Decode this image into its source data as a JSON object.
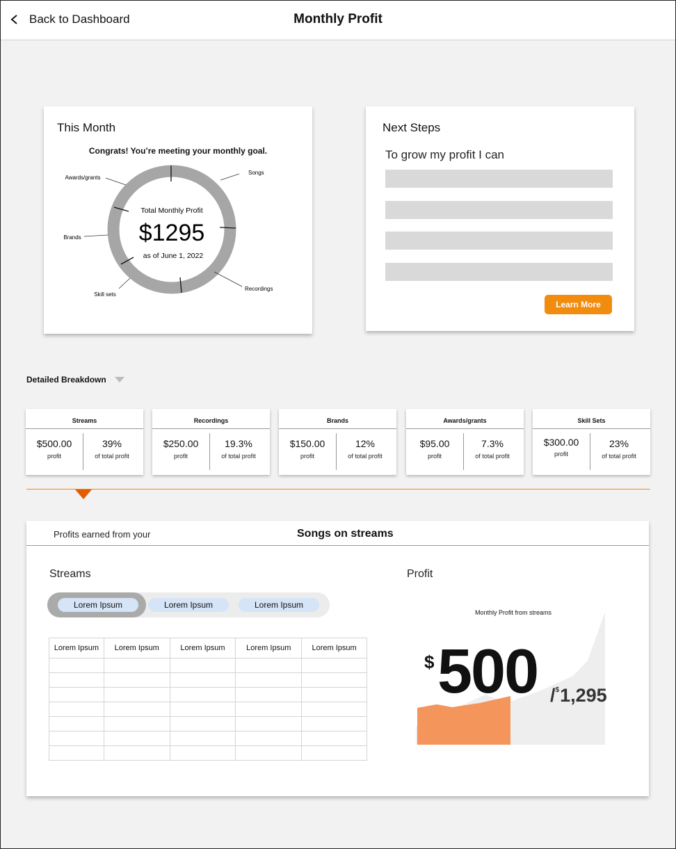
{
  "header": {
    "back_label": "Back to Dashboard",
    "title": "Monthly Profit"
  },
  "this_month": {
    "title": "This Month",
    "congrats": "Congrats! You’re meeting your monthly goal.",
    "donut_title": "Total Monthly Profit",
    "donut_value": "$1295",
    "donut_date": "as of June 1, 2022",
    "segment_labels": {
      "awards": "Awards/grants",
      "songs": "Songs",
      "brands": "Brands",
      "recordings": "Recordings",
      "skill_sets": "Skill sets"
    },
    "ring_color": "#a6a6a6"
  },
  "next_steps": {
    "title": "Next Steps",
    "subtitle": "To grow my profit I can",
    "learn_more": "Learn More",
    "accent": "#f28c0f"
  },
  "breakdown": {
    "label": "Detailed Breakdown",
    "cards": [
      {
        "title": "Streams",
        "amount": "$500.00",
        "amount_label": "profit",
        "pct": "39%",
        "pct_label": "of total profit"
      },
      {
        "title": "Recordings",
        "amount": "$250.00",
        "amount_label": "profit",
        "pct": "19.3%",
        "pct_label": "of total profit"
      },
      {
        "title": "Brands",
        "amount": "$150.00",
        "amount_label": "profit",
        "pct": "12%",
        "pct_label": "of total profit"
      },
      {
        "title": "Awards/grants",
        "amount": "$95.00",
        "amount_label": "profit",
        "pct": "7.3%",
        "pct_label": "of total profit"
      },
      {
        "title": "Skill Sets",
        "amount": "$300.00",
        "amount_label": "profit",
        "pct": "23%",
        "pct_label": "of total profit"
      }
    ]
  },
  "detail": {
    "lead": "Profits earned from your",
    "title": "Songs on streams",
    "streams_title": "Streams",
    "profit_title": "Profit",
    "pills": [
      "Lorem Ipsum",
      "Lorem Ipsum",
      "Lorem Ipsum"
    ],
    "table_headers": [
      "Lorem Ipsum",
      "Lorem Ipsum",
      "Lorem Ipsum",
      "Lorem Ipsum",
      "Lorem Ipsum"
    ],
    "chart_title": "Monthly Profit from streams",
    "dollar_sign": "$",
    "profit_value": "500",
    "total_prefix": "/",
    "total_currency": "$",
    "total_value": "1,295",
    "fill_color": "#f4955b",
    "bg_color": "#eeeeee"
  }
}
